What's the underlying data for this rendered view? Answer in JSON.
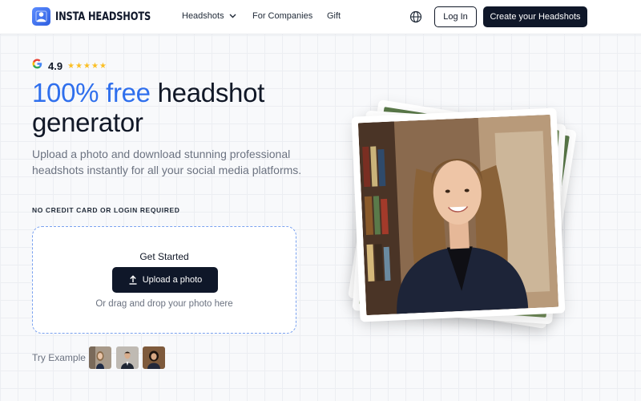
{
  "brand": {
    "name": "INSTA HEADSHOTS",
    "accent": "#2f6fed",
    "dark": "#0f1729"
  },
  "nav": {
    "headshots": "Headshots",
    "companies": "For Companies",
    "gift": "Gift",
    "login": "Log In",
    "create": "Create your Headshots"
  },
  "hero": {
    "rating_value": "4.9",
    "stars": "★★★★★",
    "headline_accent": "100% free",
    "headline_rest_1": " headshot",
    "headline_rest_2": "generator",
    "subtext": "Upload a photo and download stunning professional headshots instantly for all your social media platforms.",
    "no_cc": "NO CREDIT CARD OR LOGIN REQUIRED"
  },
  "upload": {
    "title": "Get Started",
    "button": "Upload a photo",
    "drag_text": "Or drag and drop your photo here"
  },
  "examples": {
    "label": "Try Example"
  },
  "icons": [
    "logo-icon",
    "chevron-down-icon",
    "globe-icon",
    "google-icon",
    "star-icon",
    "upload-icon"
  ]
}
